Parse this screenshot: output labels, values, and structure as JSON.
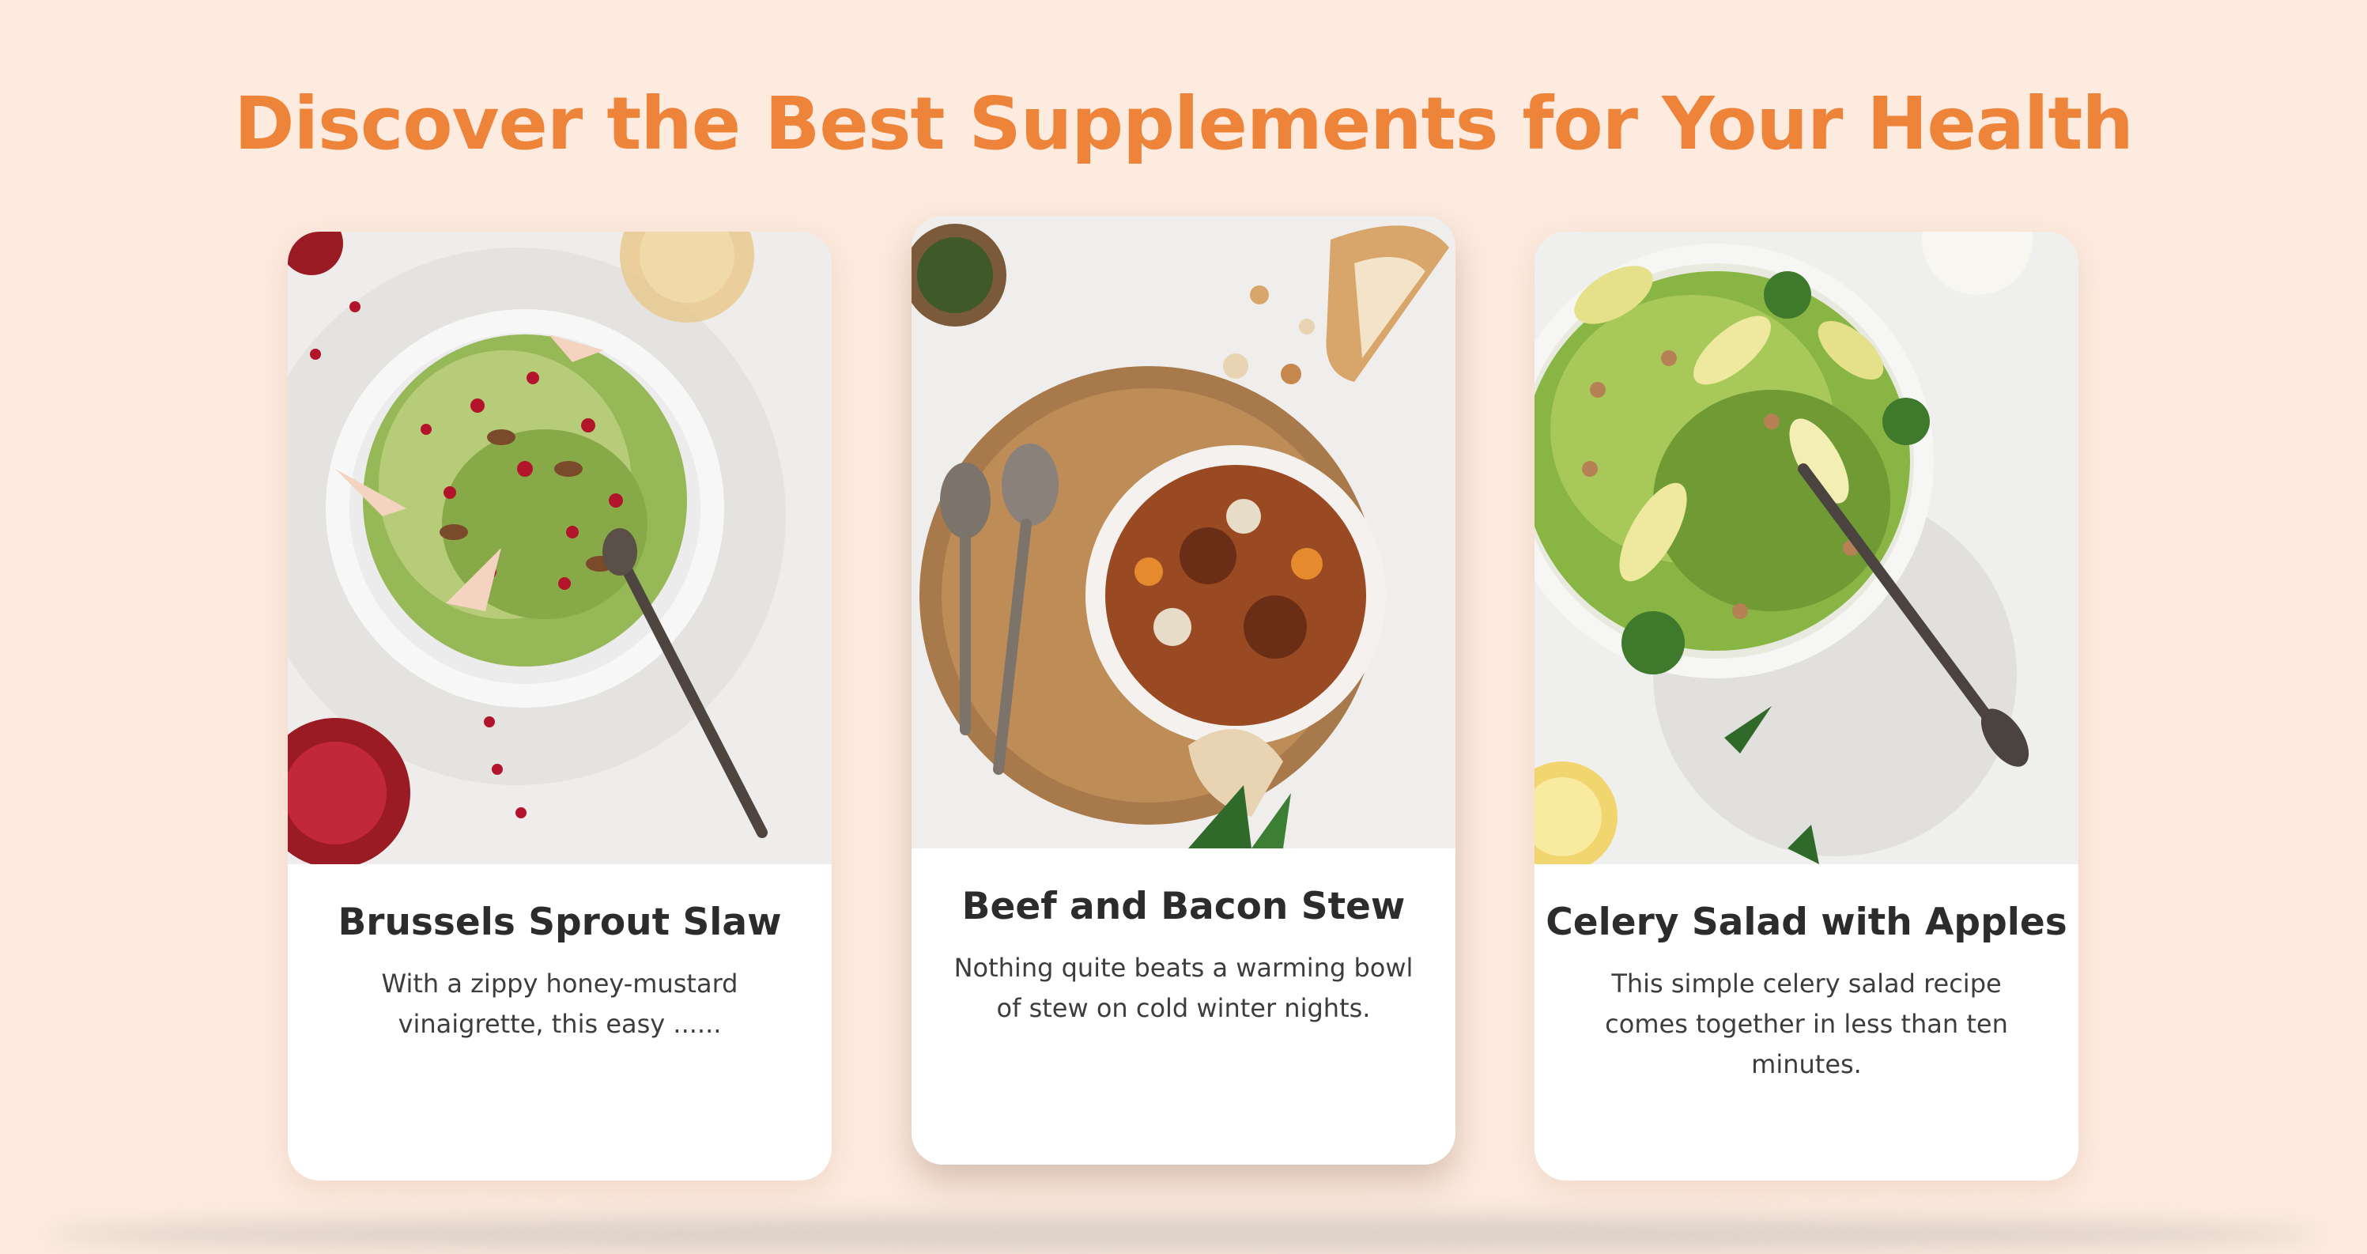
{
  "page": {
    "title": "Discover the Best Supplements for Your Health"
  },
  "cards": [
    {
      "title": "Brussels Sprout Slaw",
      "description": "With a zippy honey-mustard vinaigrette, this easy ......",
      "image": "brussels-sprout-slaw-photo"
    },
    {
      "title": "Beef and Bacon Stew",
      "description": "Nothing quite beats a warming bowl of stew on cold winter nights.",
      "image": "beef-bacon-stew-photo"
    },
    {
      "title": "Celery Salad with Apples",
      "description": "This simple celery salad recipe comes together in less than ten minutes.",
      "image": "celery-apple-salad-photo"
    }
  ],
  "colors": {
    "background": "#fdebdf",
    "accent": "#ee833a",
    "card": "#ffffff",
    "heading_text": "#2c2c2c",
    "body_text": "#3d3d3d"
  }
}
